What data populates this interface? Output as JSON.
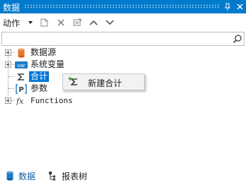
{
  "window": {
    "title": "数据"
  },
  "toolbar": {
    "action_label": "动作"
  },
  "search": {
    "value": "",
    "placeholder": ""
  },
  "tree": {
    "items": [
      {
        "label": "数据源",
        "icon": "database-icon"
      },
      {
        "label": "系统变量",
        "icon": "variable-icon"
      },
      {
        "label": "合计",
        "icon": "sigma-icon",
        "selected": true
      },
      {
        "label": "参数",
        "icon": "parameter-icon"
      },
      {
        "label": "Functions",
        "icon": "function-icon"
      }
    ]
  },
  "context_menu": {
    "items": [
      {
        "label": "新建合计",
        "icon": "new-total-icon"
      }
    ]
  },
  "tabs": [
    {
      "label": "数据",
      "icon": "database-icon",
      "active": true
    },
    {
      "label": "报表树",
      "icon": "report-tree-icon",
      "active": false
    }
  ],
  "colors": {
    "titlebar": "#007acc",
    "selection": "#0078d7",
    "accent_orange": "#e8762c"
  }
}
